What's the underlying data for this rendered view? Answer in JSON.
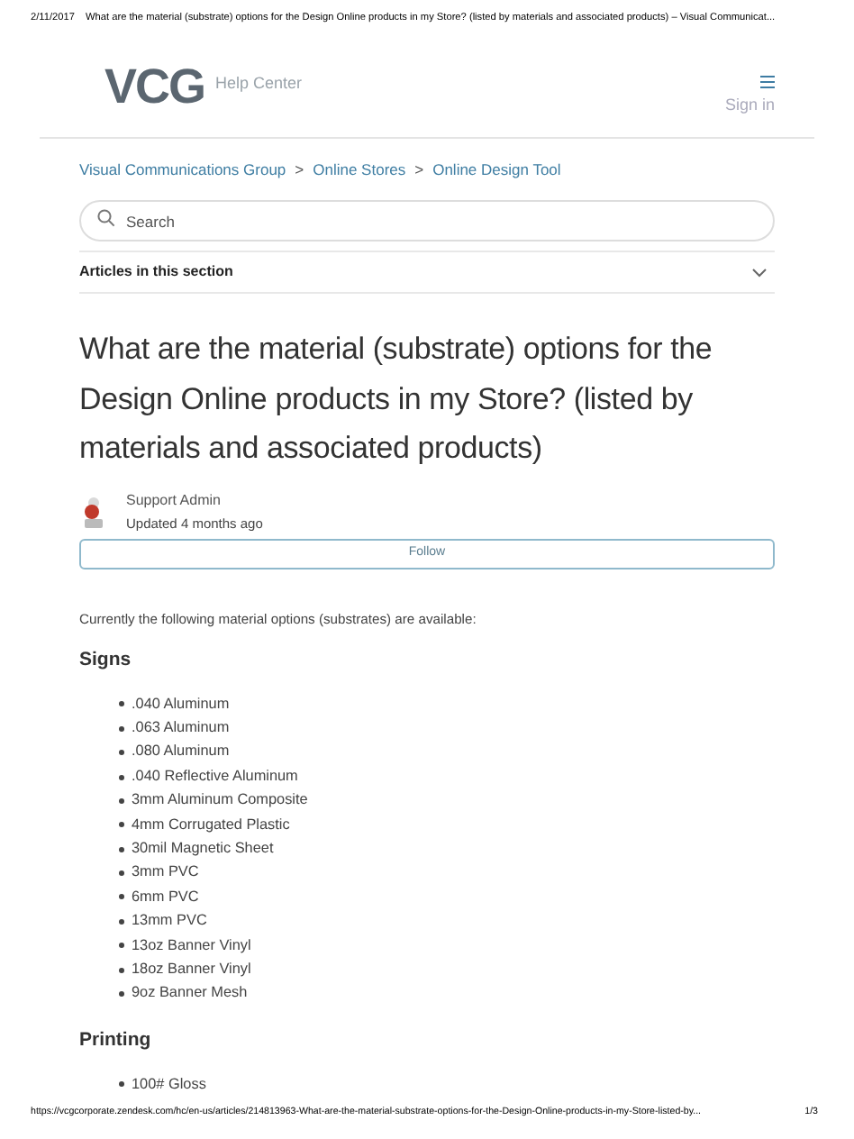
{
  "print_header": {
    "date": "2/11/2017",
    "title": "What are the material (substrate) options for the Design Online products in my Store? (listed by materials and associated products) – Visual Communicat..."
  },
  "site_header": {
    "logo": "VCG",
    "subtitle": "Help Center",
    "sign_in": "Sign in"
  },
  "breadcrumbs": [
    "Visual Communications Group",
    "Online Stores",
    "Online Design Tool"
  ],
  "breadcrumb_separator": ">",
  "search": {
    "placeholder": "Search"
  },
  "section_toggle": {
    "label": "Articles in this section",
    "expanded": false
  },
  "article": {
    "title": "What are the material (substrate) options for the Design Online products in my Store? (listed by materials and associated products)",
    "author": "Support Admin",
    "updated": "Updated 4 months ago",
    "follow_button": "Follow",
    "intro": "Currently the following material options (substrates) are available:",
    "sections": [
      {
        "heading": "Signs",
        "items": [
          ".040 Aluminum",
          ".063 Aluminum",
          ".080 Aluminum",
          ".040 Reflective Aluminum",
          "3mm Aluminum Composite",
          "4mm Corrugated Plastic",
          "30mil Magnetic Sheet",
          "3mm PVC",
          "6mm PVC",
          "13mm PVC",
          "13oz Banner Vinyl",
          "18oz Banner Vinyl",
          "9oz Banner Mesh"
        ]
      },
      {
        "heading": "Printing",
        "items": [
          "100# Gloss"
        ]
      }
    ]
  },
  "print_footer": {
    "url": "https://vcgcorporate.zendesk.com/hc/en-us/articles/214813963-What-are-the-material-substrate-options-for-the-Design-Online-products-in-my-Store-listed-by...",
    "page": "1/3"
  }
}
